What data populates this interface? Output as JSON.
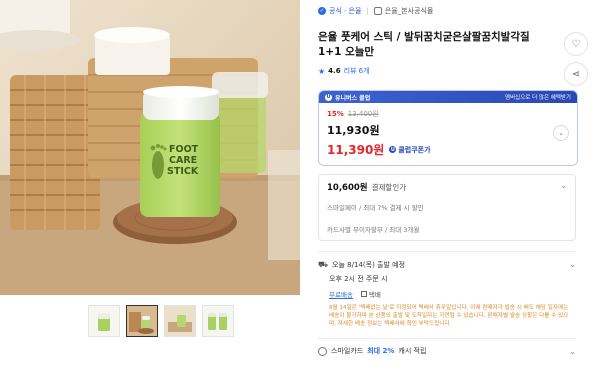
{
  "breadcrumb": {
    "badge": "공식 · 은율",
    "separator": "|",
    "store": "은율_본사공식몰"
  },
  "product": {
    "title": "은율 풋케어 스틱 / 발뒤꿈치굳은살팔꿈치발각질 1+1 오늘만",
    "rating": "4.6",
    "reviews": "리뷰 6개"
  },
  "image_labels": {
    "line1": "FOOT",
    "line2": "CARE",
    "line3": "STICK"
  },
  "price_box": {
    "header_left": "유니버스 클럽",
    "header_right": "멤버십으로 더 많은 혜택받기",
    "discount_rate": "15%",
    "original_price": "13,400원",
    "sale_price": "11,930원",
    "coupon_price": "11,390원",
    "coupon_label": "클럽쿠폰가"
  },
  "card_benefit": {
    "amount": "10,600원",
    "note": "결제할인가",
    "sub": "스마일페이 / 최대 7% 결제 시 할인",
    "installment": "카드사별 무이자할부 / 최대 3개월"
  },
  "shipping": {
    "date": "오늘 8/14(목) 출발 예정",
    "time": "오후 2시 전 주문 시",
    "free_tag": "무료배송",
    "parcel_tag": "택배",
    "notice": "8월 14일은 '택배없는 날'로 지정되어 택배사 휴무일입니다. 이에 판매자가 발송 시 배도 해당 일자에는 배송이 불가하며 본 상품의 출발 및 도착일자는 지연될 수 있습니다. 판매자별 발송 상황은 다를 수 있으며, 자세한 배송 정보는 택배사에 확인 부탁드립니다."
  },
  "smile_card": {
    "prefix": "스마일카드",
    "highlight": "최대 2%",
    "suffix": "캐시 적립"
  },
  "icons": {
    "heart": "heart-icon",
    "share": "share-icon",
    "star": "star-icon",
    "truck": "truck-icon",
    "chevron": "chevron-down-icon"
  },
  "colors": {
    "accent": "#2c6be8",
    "sale_red": "#e52528",
    "club_blue": "#2a48b4",
    "notice_orange": "#d88a2a"
  }
}
